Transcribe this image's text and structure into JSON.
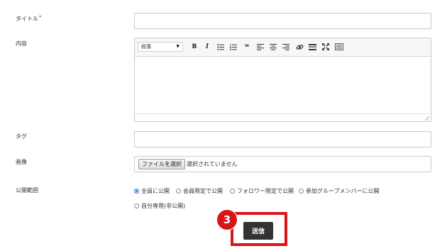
{
  "form": {
    "title_label": "タイトル",
    "required_mark": "*",
    "content_label": "内容",
    "tag_label": "タグ",
    "image_label": "画像",
    "visibility_label": "公開範囲"
  },
  "editor": {
    "format_select": "段落",
    "toolbar_icons": [
      "bold-icon",
      "italic-icon",
      "bulleted-list-icon",
      "numbered-list-icon",
      "blockquote-icon",
      "align-left-icon",
      "align-center-icon",
      "align-right-icon",
      "link-icon",
      "horizontal-rule-icon",
      "fullscreen-icon",
      "toggle-toolbar-icon"
    ],
    "bold": "B",
    "italic": "I",
    "quote": "❝"
  },
  "file": {
    "button_label": "ファイルを選択",
    "status": "選択されていません"
  },
  "visibility": {
    "options": [
      "全員に公開",
      "会員限定で公開",
      "フォロワー限定で公開",
      "参加グループメンバーに公開",
      "自分専用(非公開)"
    ],
    "selected": "全員に公開"
  },
  "submit": {
    "label": "送信"
  },
  "annotation": {
    "step": "3",
    "color": "#d9151b"
  }
}
